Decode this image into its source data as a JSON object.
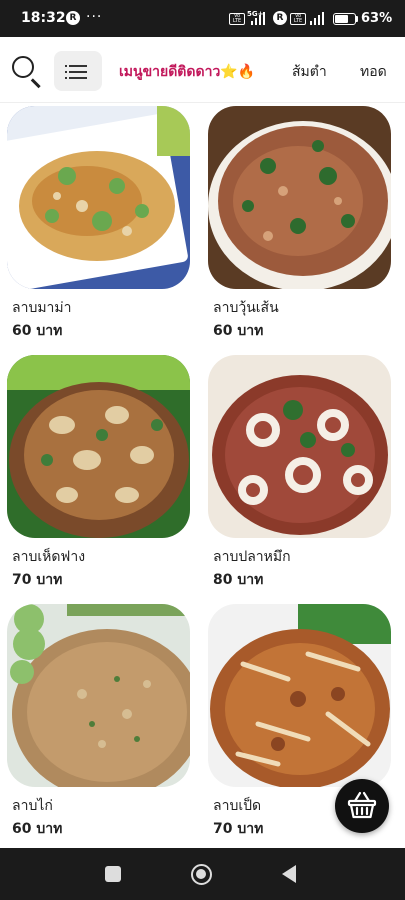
{
  "status_bar": {
    "time": "18:32",
    "notification_badge": "R",
    "overflow": "···",
    "volte_1": "Vo LTE",
    "network_1": "5G+",
    "r_badge": "R",
    "volte_2": "Vo LTE",
    "battery_percent": "63%",
    "battery_level": 0.63
  },
  "top_nav": {
    "tabs": [
      {
        "label": "เมนูขายดีติดดาว⭐🔥",
        "active": true
      },
      {
        "label": "ส้มตำ",
        "active": false
      },
      {
        "label": "ทอด",
        "active": false
      }
    ]
  },
  "menu_items": [
    {
      "name": "ลาบมาม่า",
      "price": "60 บาท",
      "photo_icon": "larb-mama-photo"
    },
    {
      "name": "ลาบวุ้นเส้น",
      "price": "60 บาท",
      "photo_icon": "larb-glass-noodle-photo"
    },
    {
      "name": "ลาบเห็ดฟาง",
      "price": "70 บาท",
      "photo_icon": "larb-mushroom-photo"
    },
    {
      "name": "ลาบปลาหมึก",
      "price": "80 บาท",
      "photo_icon": "larb-squid-photo"
    },
    {
      "name": "ลาบไก่",
      "price": "60 บาท",
      "photo_icon": "larb-chicken-photo"
    },
    {
      "name": "ลาบเป็ด",
      "price": "70 บาท",
      "photo_icon": "larb-duck-photo"
    }
  ],
  "colors": {
    "active_tab": "#c2185b",
    "status_bar_bg": "#1b1b1b",
    "cart_button_bg": "#111111"
  }
}
